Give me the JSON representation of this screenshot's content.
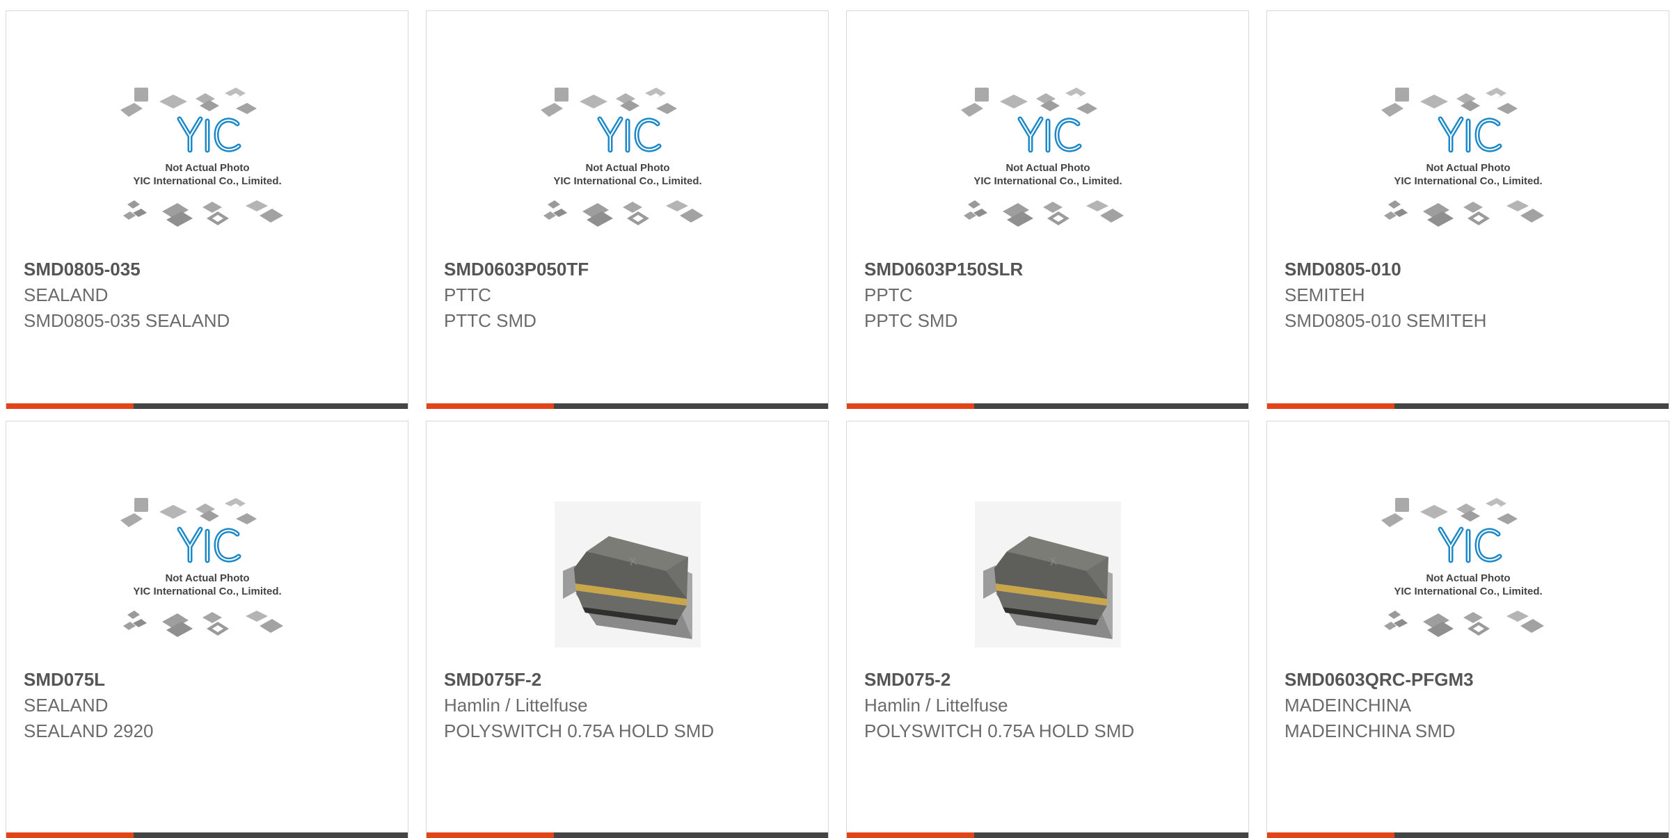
{
  "colors": {
    "accent": "#e2441a",
    "bar_dark": "#444444",
    "text_dark": "#555555",
    "text_light": "#6b6b6b",
    "logo_blue": "#1d89c8"
  },
  "placeholder": {
    "line1": "Not Actual Photo",
    "line2": "YIC International Co., Limited.",
    "logo": "YIC"
  },
  "products": [
    {
      "part": "SMD0805-035",
      "manufacturer": "SEALAND",
      "description": "SMD0805-035 SEALAND",
      "image": "placeholder-icon"
    },
    {
      "part": "SMD0603P050TF",
      "manufacturer": "PTTC",
      "description": "PTTC SMD",
      "image": "placeholder-icon"
    },
    {
      "part": "SMD0603P150SLR",
      "manufacturer": "PPTC",
      "description": "PPTC SMD",
      "image": "placeholder-icon"
    },
    {
      "part": "SMD0805-010",
      "manufacturer": "SEMITEH",
      "description": "SMD0805-010 SEMITEH",
      "image": "placeholder-icon"
    },
    {
      "part": "SMD075L",
      "manufacturer": "SEALAND",
      "description": "SEALAND 2920",
      "image": "placeholder-icon"
    },
    {
      "part": "SMD075F-2",
      "manufacturer": "Hamlin / Littelfuse",
      "description": "POLYSWITCH 0.75A HOLD SMD",
      "image": "polyswitch-chip-icon"
    },
    {
      "part": "SMD075-2",
      "manufacturer": "Hamlin / Littelfuse",
      "description": "POLYSWITCH 0.75A HOLD SMD",
      "image": "polyswitch-chip-icon"
    },
    {
      "part": "SMD0603QRC-PFGM3",
      "manufacturer": "MADEINCHINA",
      "description": "MADEINCHINA SMD",
      "image": "placeholder-icon"
    }
  ]
}
